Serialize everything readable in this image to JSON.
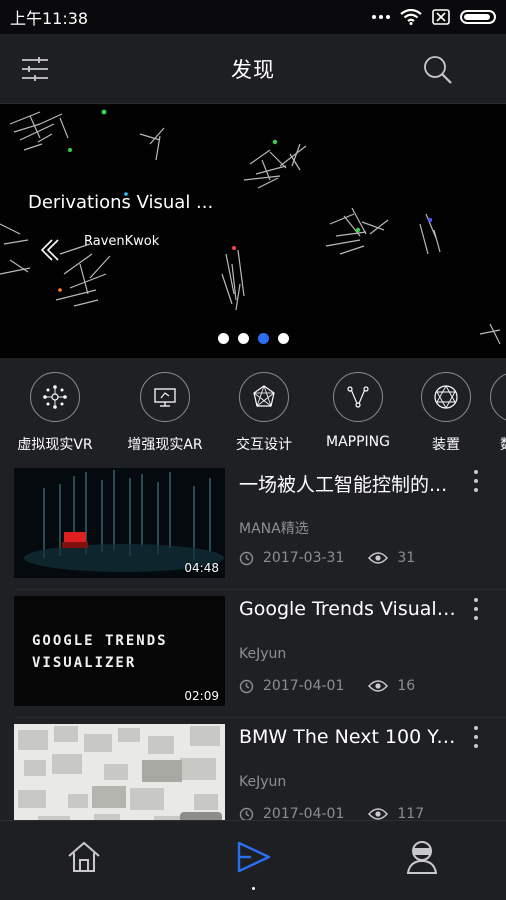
{
  "status_bar": {
    "time": "上午11:38"
  },
  "header": {
    "title": "发现"
  },
  "banner": {
    "title": "Derivations Visual ...",
    "author": "RavenKwok",
    "page_count": 4,
    "active_page": 3
  },
  "categories": [
    {
      "label": "虚拟现实VR",
      "icon": "vr-network-icon"
    },
    {
      "label": "增强现实AR",
      "icon": "ar-screen-icon"
    },
    {
      "label": "交互设计",
      "icon": "interaction-polygon-icon"
    },
    {
      "label": "MAPPING",
      "icon": "mapping-icon"
    },
    {
      "label": "装置",
      "icon": "installation-icon"
    },
    {
      "label": "数",
      "icon": "data-icon"
    }
  ],
  "videos": [
    {
      "title": "一场被人工智能控制的...",
      "author": "MANA精选",
      "date": "2017-03-31",
      "views": "31",
      "duration": "04:48"
    },
    {
      "title": "Google Trends Visualiz...",
      "author": "KeJyun",
      "date": "2017-04-01",
      "views": "16",
      "duration": "02:09",
      "thumb_text_1": "GOOGLE TRENDS",
      "thumb_text_2": "VISUALIZER"
    },
    {
      "title": "BMW The Next 100 Yea...",
      "author": "KeJyun",
      "date": "2017-04-01",
      "views": "117",
      "duration": ""
    }
  ],
  "tab_bar": {
    "active": "discover",
    "items": [
      "home-icon",
      "discover-play-icon",
      "profile-vr-icon"
    ]
  },
  "colors": {
    "accent": "#2a6ff0",
    "background": "#1f2023",
    "muted": "#8d8e92"
  }
}
